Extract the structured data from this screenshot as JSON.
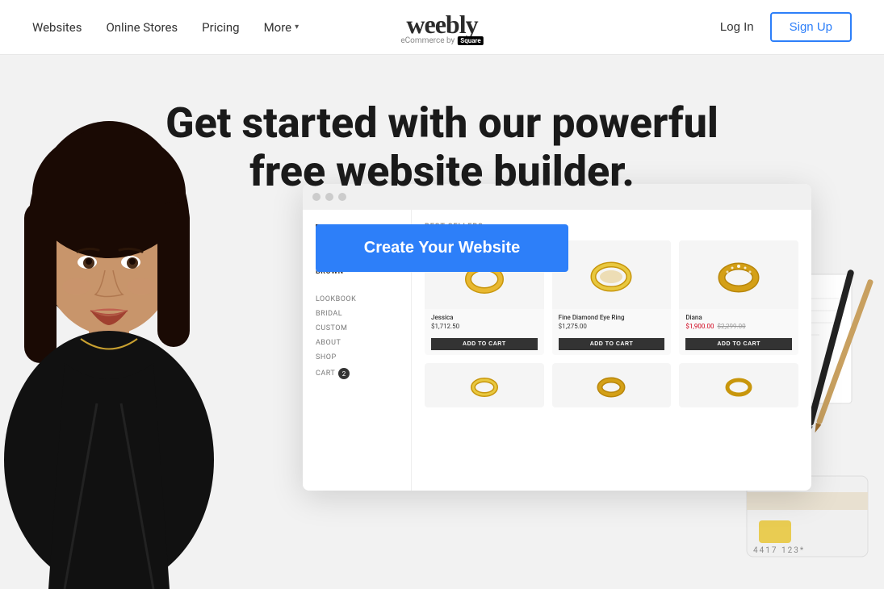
{
  "header": {
    "nav": {
      "websites": "Websites",
      "online_stores": "Online Stores",
      "pricing": "Pricing",
      "more": "More",
      "login": "Log In",
      "signup": "Sign Up"
    },
    "logo": {
      "name": "weebly",
      "tagline": "eCommerce by",
      "square": "Square"
    }
  },
  "hero": {
    "headline": "Get started with our powerful free website builder.",
    "cta": "Create Your Website"
  },
  "preview": {
    "brand": "BLAIR LAUREN BROWN",
    "nav_items": [
      "LOOKBOOK",
      "BRIDAL",
      "CUSTOM",
      "ABOUT",
      "SHOP"
    ],
    "cart": "CART",
    "cart_count": "2",
    "section_label": "BEST SELLERS",
    "products": [
      {
        "name": "Jessica",
        "price": "$1,712.50",
        "add_to_cart": "ADD TO CART"
      },
      {
        "name": "Fine Diamond Eye Ring",
        "price": "$1,275.00",
        "add_to_cart": "ADD TO CART"
      },
      {
        "name": "Diana",
        "price_sale": "$1,900.00",
        "price_original": "$2,299.00",
        "add_to_cart": "ADD TO CART"
      }
    ]
  }
}
